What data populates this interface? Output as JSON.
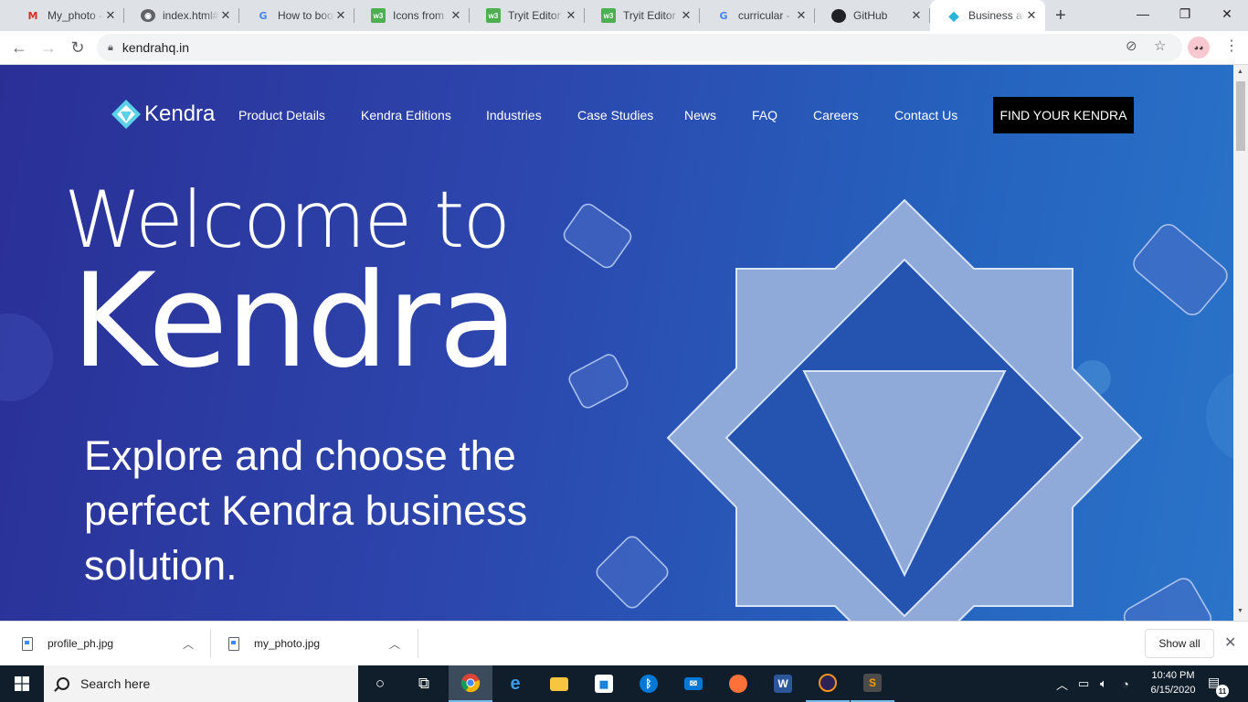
{
  "browser": {
    "tabs": [
      {
        "title": "My_photo -",
        "favicon": "gmail-icon",
        "active": false
      },
      {
        "title": "index.html#",
        "favicon": "globe-icon",
        "active": false
      },
      {
        "title": "How to boo",
        "favicon": "google-icon",
        "active": false
      },
      {
        "title": "Icons from",
        "favicon": "w3schools-icon",
        "active": false
      },
      {
        "title": "Tryit Editor",
        "favicon": "w3schools-icon",
        "active": false
      },
      {
        "title": "Tryit Editor",
        "favicon": "w3schools-icon",
        "active": false
      },
      {
        "title": "curricular -",
        "favicon": "google-icon",
        "active": false
      },
      {
        "title": "GitHub",
        "favicon": "github-icon",
        "active": false
      },
      {
        "title": "Business au",
        "favicon": "kendra-icon",
        "active": true
      }
    ],
    "new_tab_symbol": "+",
    "address": "kendrahq.in"
  },
  "site": {
    "brand": "Kendra",
    "nav": [
      "Product Details",
      "Kendra Editions",
      "Industries",
      "Case Studies",
      "News",
      "FAQ",
      "Careers",
      "Contact Us"
    ],
    "cta": "FIND YOUR KENDRA",
    "hero_line1": "Welcome to",
    "hero_line2": "Kendra",
    "tagline": "Explore and choose the perfect Kendra business solution.",
    "colors": {
      "bg_left": "#2a2f96",
      "bg_right": "#2a74c9",
      "emblem_fill": "#8fa9d9",
      "cta_bg": "#000000"
    }
  },
  "downloads": {
    "items": [
      {
        "name": "profile_ph.jpg"
      },
      {
        "name": "my_photo.jpg"
      }
    ],
    "show_all": "Show all"
  },
  "taskbar": {
    "search_placeholder": "Search here",
    "apps": [
      "cortana-icon",
      "task-view-icon",
      "chrome-icon",
      "edge-icon",
      "file-explorer-icon",
      "store-icon",
      "bluetooth-icon",
      "mail-icon",
      "firefox-icon",
      "word-icon",
      "eclipse-icon",
      "sublime-text-icon"
    ],
    "time": "10:40 PM",
    "date": "6/15/2020",
    "notification_count": "11"
  }
}
